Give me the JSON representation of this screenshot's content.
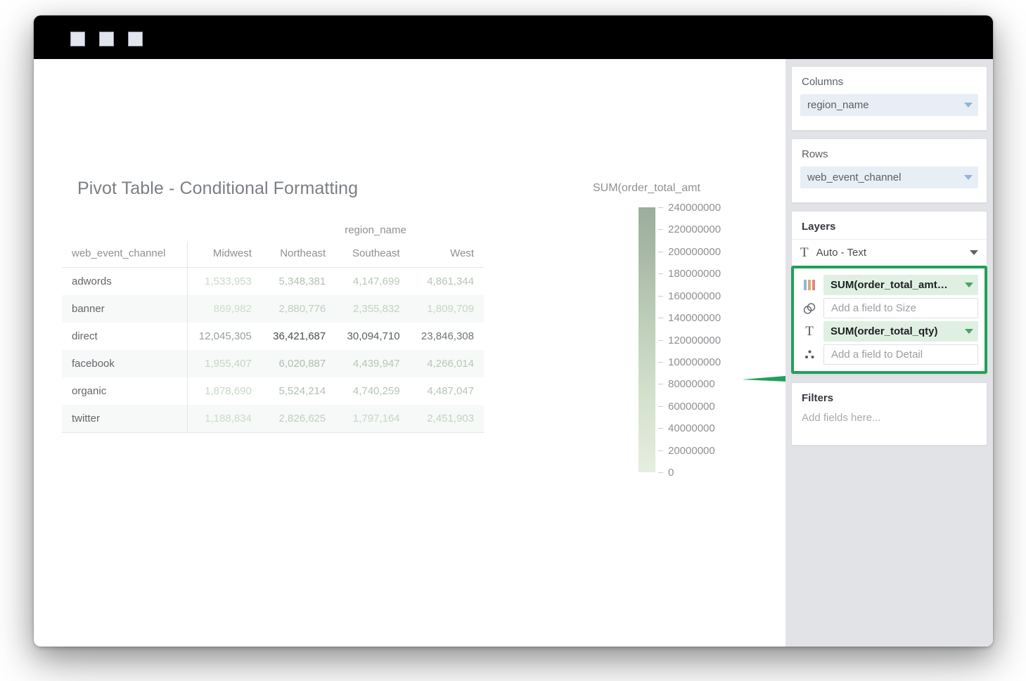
{
  "window": {
    "titlebar_buttons": [
      "square-1",
      "square-2",
      "square-3"
    ]
  },
  "viz": {
    "title": "Pivot Table - Conditional Formatting"
  },
  "chart_data": {
    "type": "table",
    "title": "Pivot Table - Conditional Formatting",
    "column_group_label": "region_name",
    "row_header": "web_event_channel",
    "categories": [
      "Midwest",
      "Northeast",
      "Southeast",
      "West"
    ],
    "rows": [
      {
        "label": "adwords",
        "values": [
          "1,533,953",
          "5,348,381",
          "4,147,699",
          "4,861,344"
        ],
        "numeric": [
          1533953,
          5348381,
          4147699,
          4861344
        ]
      },
      {
        "label": "banner",
        "values": [
          "869,982",
          "2,880,776",
          "2,355,832",
          "1,809,709"
        ],
        "numeric": [
          869982,
          2880776,
          2355832,
          1809709
        ]
      },
      {
        "label": "direct",
        "values": [
          "12,045,305",
          "36,421,687",
          "30,094,710",
          "23,846,308"
        ],
        "numeric": [
          12045305,
          36421687,
          30094710,
          23846308
        ]
      },
      {
        "label": "facebook",
        "values": [
          "1,955,407",
          "6,020,887",
          "4,439,947",
          "4,266,014"
        ],
        "numeric": [
          1955407,
          6020887,
          4439947,
          4266014
        ]
      },
      {
        "label": "organic",
        "values": [
          "1,878,690",
          "5,524,214",
          "4,740,259",
          "4,487,047"
        ],
        "numeric": [
          1878690,
          5524214,
          4740259,
          4487047
        ]
      },
      {
        "label": "twitter",
        "values": [
          "1,188,834",
          "2,826,625",
          "1,797,164",
          "2,451,903"
        ],
        "numeric": [
          1188834,
          2826625,
          1797164,
          2451903
        ]
      }
    ],
    "legend": {
      "title": "SUM(order_total_amt",
      "position": "right",
      "orientation": "vertical",
      "scale_min": 0,
      "scale_max": 240000000,
      "gradient_low": "#e4efe0",
      "gradient_high": "#9cae9b",
      "ticks": [
        "240000000",
        "220000000",
        "200000000",
        "180000000",
        "160000000",
        "140000000",
        "120000000",
        "100000000",
        "80000000",
        "60000000",
        "40000000",
        "20000000",
        "0"
      ]
    }
  },
  "panel": {
    "columns": {
      "title": "Columns",
      "field": "region_name"
    },
    "rows": {
      "title": "Rows",
      "field": "web_event_channel"
    },
    "layers": {
      "title": "Layers",
      "mark": "Auto - Text",
      "encodings": [
        {
          "icon": "color-bars-icon",
          "name": "color",
          "value": "SUM(order_total_amt…",
          "filled": true
        },
        {
          "icon": "size-circles-icon",
          "name": "size",
          "value": "Add a field to Size",
          "filled": false
        },
        {
          "icon": "text-t-icon",
          "name": "text",
          "value": "SUM(order_total_qty)",
          "filled": true
        },
        {
          "icon": "detail-dots-icon",
          "name": "detail",
          "value": "Add a field to Detail",
          "filled": false
        }
      ]
    },
    "filters": {
      "title": "Filters",
      "placeholder": "Add fields here..."
    }
  },
  "annotation": {
    "arrow_color": "#21a05a",
    "highlight_color": "#21a05a"
  }
}
